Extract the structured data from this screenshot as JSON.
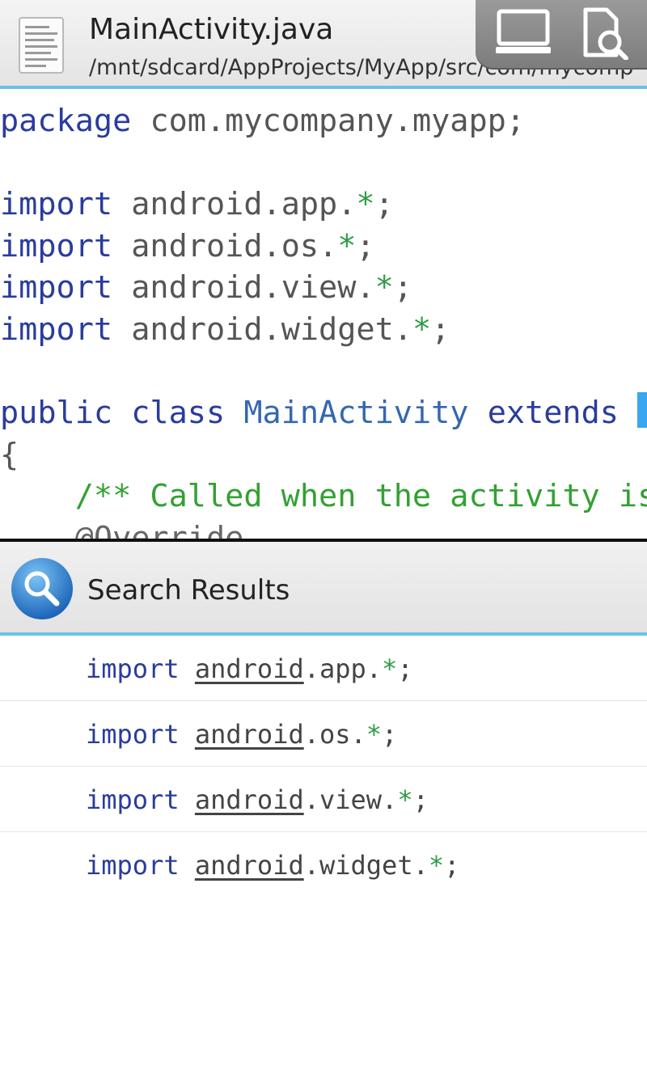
{
  "titlebar": {
    "file_name": "MainActivity.java",
    "file_path": "/mnt/sdcard/AppProjects/MyApp/src/com/mycomp",
    "icons": [
      "document-icon",
      "monitor-icon",
      "file-search-icon"
    ]
  },
  "editor": {
    "lines": [
      {
        "kw": "package",
        "rest": " com.mycompany.myapp;"
      },
      {
        "blank": true
      },
      {
        "kw": "import",
        "pkg": " android.app.",
        "star": "*",
        "end": ";"
      },
      {
        "kw": "import",
        "pkg": " android.os.",
        "star": "*",
        "end": ";"
      },
      {
        "kw": "import",
        "pkg": " android.view.",
        "star": "*",
        "end": ";"
      },
      {
        "kw": "import",
        "pkg": " android.widget.",
        "star": "*",
        "end": ";"
      },
      {
        "blank": true
      },
      {
        "kw": "public class",
        "cls": "MainActivity",
        "kw2": "extends"
      },
      {
        "text": "{"
      },
      {
        "comment": "    /** Called when the activity is"
      },
      {
        "annotation": "    @Override"
      }
    ]
  },
  "search": {
    "title": "Search Results",
    "results": [
      {
        "kw": "import",
        "match": "android",
        "rest": ".app.",
        "star": "*",
        "end": ";"
      },
      {
        "kw": "import",
        "match": "android",
        "rest": ".os.",
        "star": "*",
        "end": ";"
      },
      {
        "kw": "import",
        "match": "android",
        "rest": ".view.",
        "star": "*",
        "end": ";"
      },
      {
        "kw": "import",
        "match": "android",
        "rest": ".widget.",
        "star": "*",
        "end": ";"
      }
    ]
  },
  "colors": {
    "accent": "#6cc2e6",
    "keyword": "#2a3c9c",
    "class_name": "#3567b0",
    "comment": "#33a033",
    "cursor": "#3aa5f0"
  }
}
